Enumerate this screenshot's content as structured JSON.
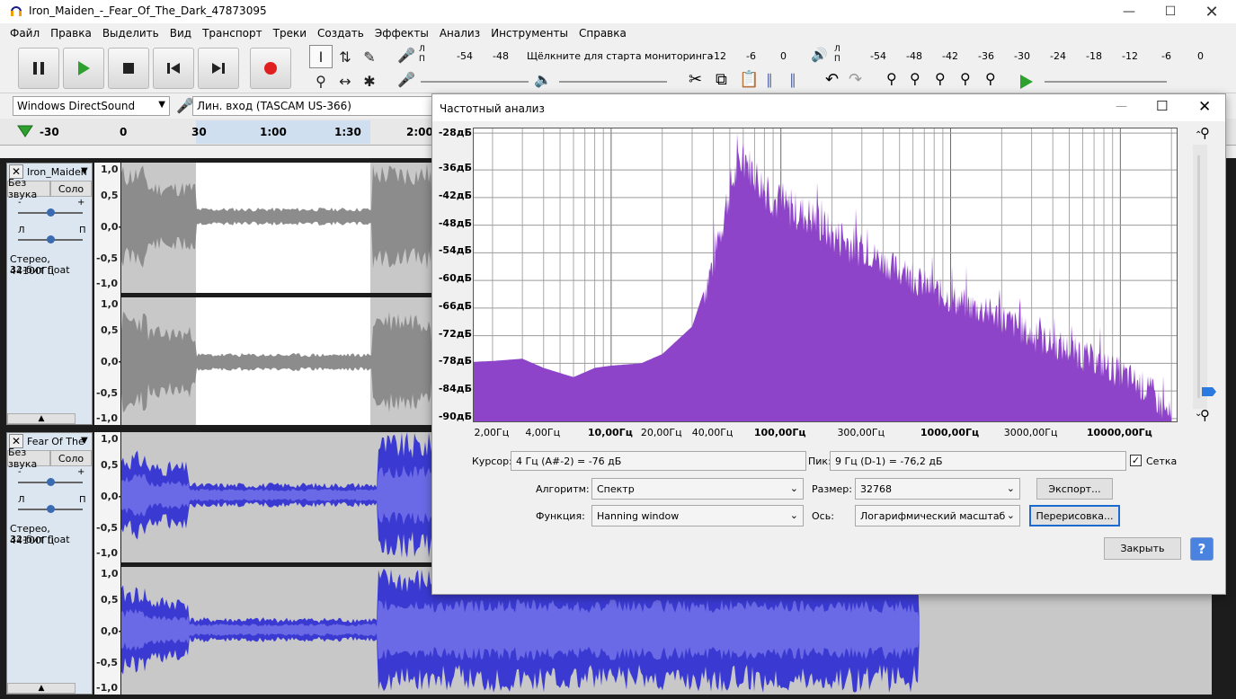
{
  "window": {
    "title": "Iron_Maiden_-_Fear_Of_The_Dark_47873095"
  },
  "menu": [
    "Файл",
    "Правка",
    "Выделить",
    "Вид",
    "Транспорт",
    "Треки",
    "Создать",
    "Эффекты",
    "Анализ",
    "Инструменты",
    "Справка"
  ],
  "meter": {
    "rec_ticks": [
      "-54",
      "-48",
      "-12",
      "-6",
      "0"
    ],
    "rec_prompt": "Щёлкните для старта мониторинга",
    "play_ticks": [
      "-54",
      "-48",
      "-42",
      "-36",
      "-30",
      "-24",
      "-18",
      "-12",
      "-6",
      "0"
    ],
    "lp": [
      "Л",
      "П"
    ]
  },
  "devices": {
    "host": "Windows DirectSound",
    "input": "Лин. вход (TASCAM US-366)"
  },
  "timeline": {
    "ticks": [
      "-30",
      "0",
      "30",
      "1:00",
      "1:30",
      "2:00"
    ]
  },
  "tracks": [
    {
      "name": "Iron_Maiden",
      "mute": "Без звука",
      "solo": "Соло",
      "pan_labels": [
        "Л",
        "П"
      ],
      "gain_labels": [
        "-",
        "+"
      ],
      "info1": "Стерео, 44100Гц",
      "info2": "32-бит float",
      "scale": [
        "1,0",
        "0,5",
        "0,0-",
        "-0,5",
        "-1,0"
      ],
      "color": "#8c8c8c"
    },
    {
      "name": "Fear Of The",
      "mute": "Без звука",
      "solo": "Соло",
      "pan_labels": [
        "Л",
        "П"
      ],
      "gain_labels": [
        "-",
        "+"
      ],
      "info1": "Стерео, 44100Гц",
      "info2": "32-бит float",
      "scale": [
        "1,0",
        "0,5",
        "0,0-",
        "-0,5",
        "-1,0"
      ],
      "color": "#3a3ad2"
    }
  ],
  "dialog": {
    "title": "Частотный анализ",
    "db_ticks": [
      "-28дБ",
      "-36дБ",
      "-42дБ",
      "-48дБ",
      "-54дБ",
      "-60дБ",
      "-66дБ",
      "-72дБ",
      "-78дБ",
      "-84дБ",
      "-90дБ"
    ],
    "freq_ticks": [
      "2,00Гц",
      "4,00Гц",
      "10,00Гц",
      "20,00Гц",
      "40,00Гц",
      "100,00Гц",
      "300,00Гц",
      "1000,00Гц",
      "3000,00Гц",
      "10000,00Гц"
    ],
    "cursor_label": "Курсор:",
    "cursor_value": "4 Гц (A#-2) = -76 дБ",
    "peak_label": "Пик:",
    "peak_value": "9 Гц (D-1) = -76,2 дБ",
    "grid_label": "Сетка",
    "algorithm_label": "Алгоритм:",
    "algorithm_value": "Спектр",
    "size_label": "Размер:",
    "size_value": "32768",
    "export_button": "Экспорт...",
    "function_label": "Функция:",
    "function_value": "Hanning window",
    "axis_label": "Ось:",
    "axis_value": "Логарифмический масштаб",
    "replot_button": "Перерисовка...",
    "close_button": "Закрыть",
    "help_button": "?"
  },
  "chart_data": {
    "type": "area",
    "title": "",
    "xlabel": "",
    "ylabel": "",
    "x_scale": "log",
    "ylim": [
      -91,
      -27
    ],
    "x": [
      1,
      2,
      3,
      4,
      6,
      8,
      10,
      15,
      20,
      30,
      40,
      50,
      60,
      80,
      100,
      150,
      200,
      300,
      500,
      1000,
      2000,
      3000,
      5000,
      10000,
      15000,
      20000
    ],
    "values": [
      -78,
      -77.5,
      -77,
      -79,
      -81,
      -79,
      -78.5,
      -78,
      -76,
      -70,
      -56,
      -40,
      -33,
      -40,
      -44,
      -46,
      -50,
      -53,
      -58,
      -64,
      -68,
      -72,
      -75,
      -80,
      -84,
      -90
    ],
    "grid": true,
    "fill_color": "#8e44c8"
  }
}
